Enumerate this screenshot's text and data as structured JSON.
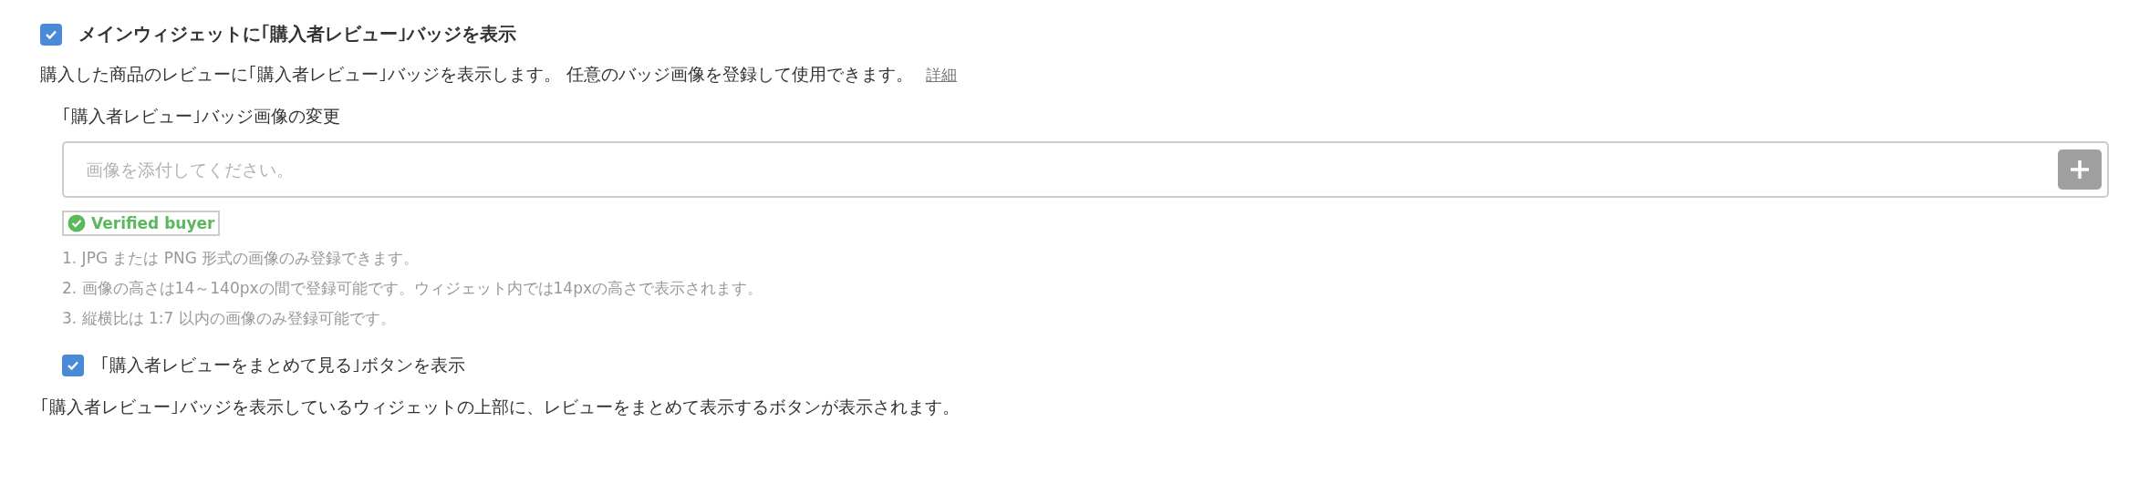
{
  "main_option": {
    "label": "メインウィジェットに｢購入者レビュー｣バッジを表示",
    "checked": true
  },
  "description": "購入した商品のレビューに｢購入者レビュー｣バッジを表示します。 任意のバッジ画像を登録して使用できます。",
  "details_link": "詳細",
  "badge_image": {
    "label": "｢購入者レビュー｣バッジ画像の変更",
    "placeholder": "画像を添付してください。",
    "preview_badge": "Verified buyer",
    "notes": [
      "1. JPG または PNG 形式の画像のみ登録できます。",
      "2. 画像の高さは14～140pxの間で登録可能です。ウィジェット内では14pxの高さで表示されます。",
      "3. 縦横比は 1:7 以内の画像のみ登録可能です。"
    ]
  },
  "summary_option": {
    "label": "｢購入者レビューをまとめて見る｣ボタンを表示",
    "checked": true,
    "description": "｢購入者レビュー｣バッジを表示しているウィジェットの上部に、レビューをまとめて表示するボタンが表示されます。"
  }
}
